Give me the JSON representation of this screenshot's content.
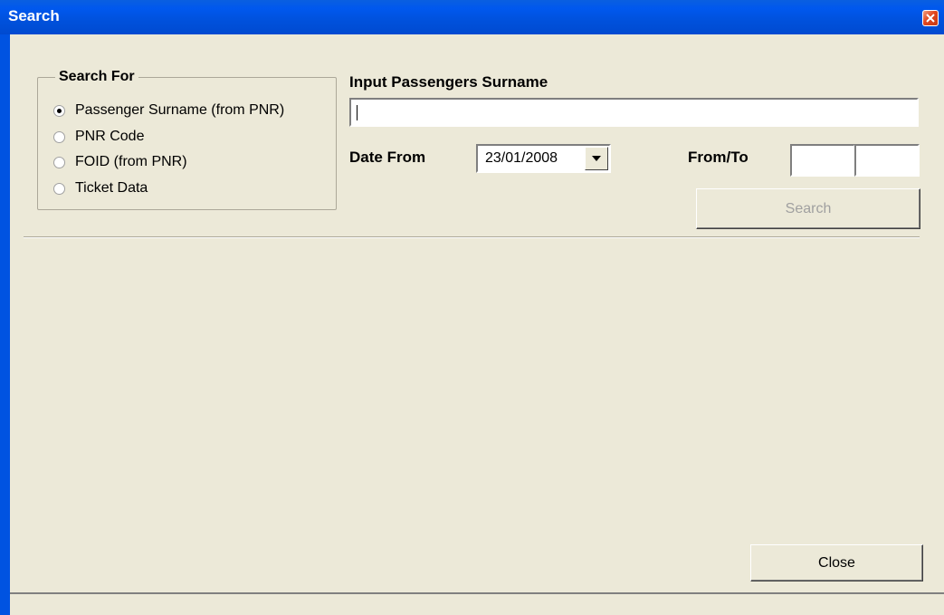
{
  "window": {
    "title": "Search"
  },
  "search_for": {
    "label": "Search For",
    "options": [
      {
        "label": "Passenger Surname (from PNR)",
        "checked": true
      },
      {
        "label": "PNR Code",
        "checked": false
      },
      {
        "label": "FOID (from PNR)",
        "checked": false
      },
      {
        "label": "Ticket Data",
        "checked": false
      }
    ]
  },
  "surname_input": {
    "label": "Input Passengers Surname",
    "value": ""
  },
  "date_from": {
    "label": "Date From",
    "value": "23/01/2008"
  },
  "from_to": {
    "label": "From/To",
    "from_value": "",
    "to_value": ""
  },
  "buttons": {
    "search_label": "Search",
    "close_label": "Close"
  },
  "icons": {
    "close": "close-icon",
    "dropdown": "chevron-down-icon"
  }
}
